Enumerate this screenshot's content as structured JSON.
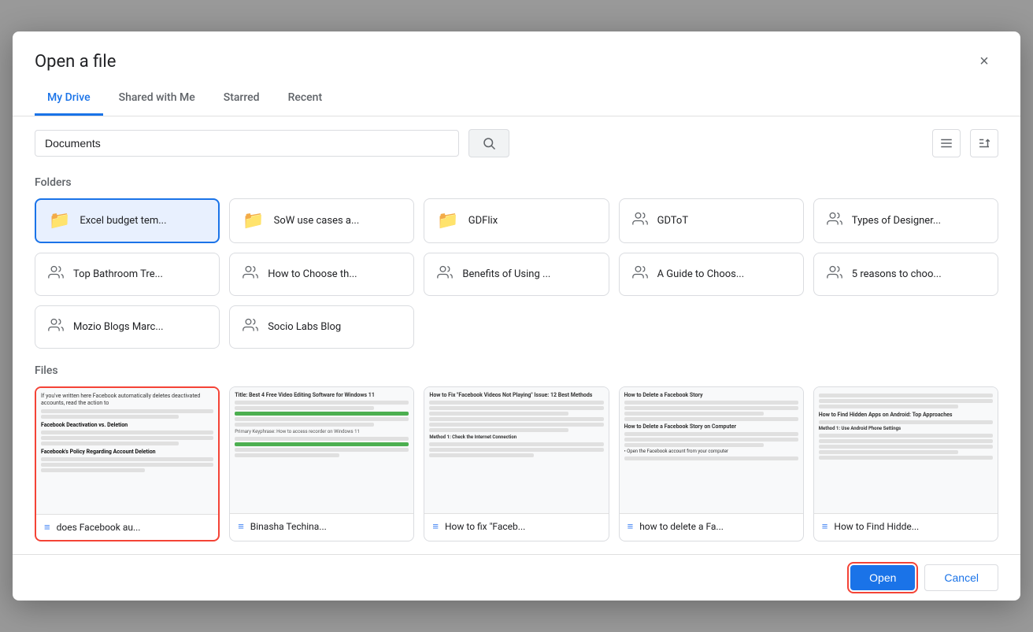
{
  "dialog": {
    "title": "Open a file",
    "close_label": "×"
  },
  "tabs": [
    {
      "id": "my-drive",
      "label": "My Drive",
      "active": true
    },
    {
      "id": "shared-with-me",
      "label": "Shared with Me",
      "active": false
    },
    {
      "id": "starred",
      "label": "Starred",
      "active": false
    },
    {
      "id": "recent",
      "label": "Recent",
      "active": false
    }
  ],
  "toolbar": {
    "search_value": "Documents",
    "search_placeholder": "Search",
    "list_view_icon": "≡",
    "sort_icon": "AZ"
  },
  "sections": {
    "folders_label": "Folders",
    "files_label": "Files"
  },
  "folders": [
    {
      "id": "excel-budget",
      "name": "Excel budget tem...",
      "type": "folder",
      "selected": true
    },
    {
      "id": "sow-use-cases",
      "name": "SoW use cases a...",
      "type": "folder",
      "selected": false
    },
    {
      "id": "gdflix",
      "name": "GDFlix",
      "type": "folder",
      "selected": false
    },
    {
      "id": "gdtot",
      "name": "GDToT",
      "type": "shared",
      "selected": false
    },
    {
      "id": "types-designer",
      "name": "Types of Designer...",
      "type": "shared",
      "selected": false
    },
    {
      "id": "top-bathroom",
      "name": "Top Bathroom Tre...",
      "type": "shared",
      "selected": false
    },
    {
      "id": "how-to-choose",
      "name": "How to Choose th...",
      "type": "shared",
      "selected": false
    },
    {
      "id": "benefits-using",
      "name": "Benefits of Using ...",
      "type": "shared",
      "selected": false
    },
    {
      "id": "guide-to-choos",
      "name": "A Guide to Choos...",
      "type": "shared",
      "selected": false
    },
    {
      "id": "5-reasons",
      "name": "5 reasons to choo...",
      "type": "shared",
      "selected": false
    },
    {
      "id": "mozio-blogs",
      "name": "Mozio Blogs Marc...",
      "type": "shared",
      "selected": false
    },
    {
      "id": "socio-labs",
      "name": "Socio Labs Blog",
      "type": "shared",
      "selected": false
    }
  ],
  "files": [
    {
      "id": "file1",
      "name": "does Facebook au...",
      "type": "doc",
      "selected": true
    },
    {
      "id": "file2",
      "name": "Binasha Techina...",
      "type": "doc",
      "selected": false
    },
    {
      "id": "file3",
      "name": "How to fix \"Faceb...",
      "type": "doc",
      "selected": false
    },
    {
      "id": "file4",
      "name": "how to delete a Fa...",
      "type": "doc",
      "selected": false
    },
    {
      "id": "file5",
      "name": "How to Find Hidde...",
      "type": "doc",
      "selected": false
    }
  ],
  "footer": {
    "open_label": "Open",
    "cancel_label": "Cancel"
  }
}
